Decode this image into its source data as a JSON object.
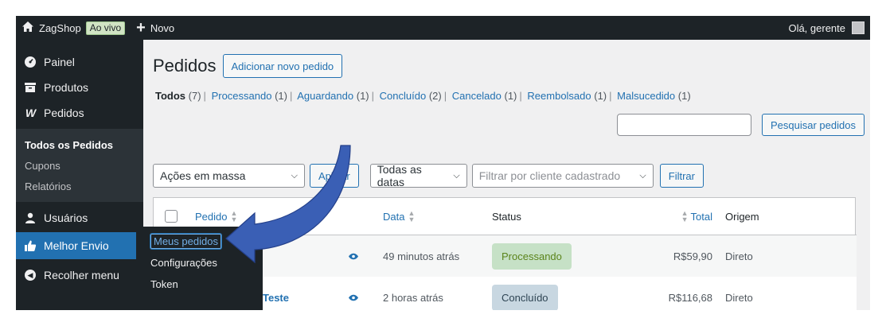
{
  "adminbar": {
    "site_name": "ZagShop",
    "live_badge": "Ao vivo",
    "new_label": "Novo",
    "greeting": "Olá, gerente"
  },
  "sidebar": {
    "items": [
      {
        "label": "Painel",
        "icon": "dashboard-icon"
      },
      {
        "label": "Produtos",
        "icon": "products-icon"
      },
      {
        "label": "Pedidos",
        "icon": "woo-icon"
      },
      {
        "label": "Usuários",
        "icon": "users-icon"
      },
      {
        "label": "Melhor Envio",
        "icon": "thumbs-up-icon"
      },
      {
        "label": "Recolher menu",
        "icon": "collapse-icon"
      }
    ],
    "submenu": [
      "Todos os Pedidos",
      "Cupons",
      "Relatórios"
    ],
    "flyout": [
      "Meus pedidos",
      "Configurações",
      "Token"
    ]
  },
  "main": {
    "title": "Pedidos",
    "add_new": "Adicionar novo pedido",
    "views": [
      {
        "label": "Todos",
        "count": "(7)"
      },
      {
        "label": "Processando",
        "count": "(1)"
      },
      {
        "label": "Aguardando",
        "count": "(1)"
      },
      {
        "label": "Concluído",
        "count": "(2)"
      },
      {
        "label": "Cancelado",
        "count": "(1)"
      },
      {
        "label": "Reembolsado",
        "count": "(1)"
      },
      {
        "label": "Malsucedido",
        "count": "(1)"
      }
    ],
    "search_button": "Pesquisar pedidos",
    "bulk_actions": "Ações em massa",
    "apply": "Aplicar",
    "dates": "Todas as datas",
    "customer_placeholder": "Filtrar por cliente cadastrado",
    "filter": "Filtrar",
    "columns": [
      "Pedido",
      "Data",
      "Status",
      "Total",
      "Origem"
    ],
    "rows": [
      {
        "order": "",
        "date": "49 minutos atrás",
        "status": "Processando",
        "total": "R$59,90",
        "origin": "Direto"
      },
      {
        "order": "Teste",
        "date": "2 horas atrás",
        "status": "Concluído",
        "total": "R$116,68",
        "origin": "Direto"
      }
    ]
  },
  "colors": {
    "adminbar": "#1d2327",
    "accent": "#2271b1",
    "arrow": "#3a5fb5"
  }
}
